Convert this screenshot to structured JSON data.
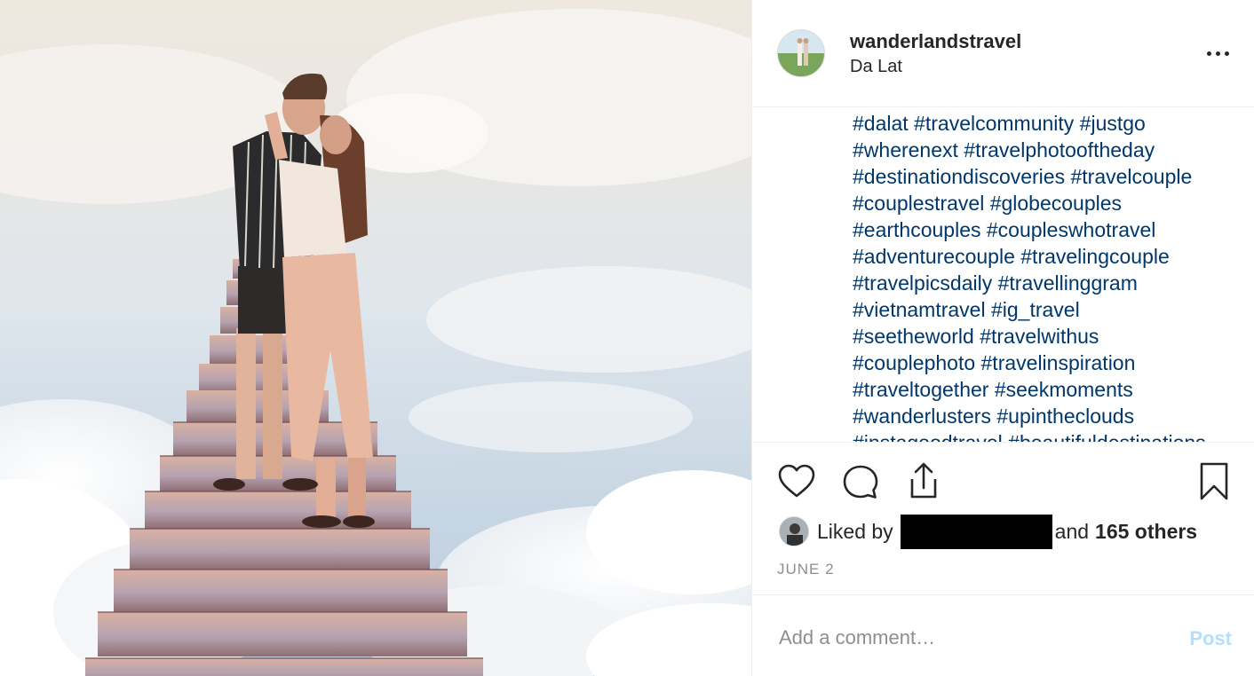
{
  "post": {
    "username": "wanderlandstravel",
    "location": "Da Lat",
    "hashtag_lines": [
      "#dalat #travelcommunity #justgo",
      "#wherenext #travelphotooftheday",
      "#destinationdiscoveries #travelcouple",
      "#couplestravel #globecouples",
      "#earthcouples #coupleswhotravel",
      "#adventurecouple #travelingcouple",
      "#travelpicsdaily #travellinggram",
      "#vietnamtravel #ig_travel",
      "#seetheworld #travelwithus",
      "#couplephoto #travelinspiration",
      "#traveltogether #seekmoments",
      "#wanderlusters #upintheclouds",
      "#instagoodtravel #beautifuldestinations"
    ],
    "likes": {
      "prefix": "Liked by",
      "connector": "and",
      "others": "165 others"
    },
    "date": "JUNE 2",
    "comment": {
      "placeholder": "Add a comment…",
      "post_label": "Post"
    }
  },
  "icons": {
    "like": "heart-icon",
    "comment": "comment-icon",
    "share": "share-icon",
    "save": "bookmark-icon",
    "more": "more-options-icon"
  },
  "colors": {
    "hashtag": "#00376b",
    "text": "#262626",
    "muted": "#8e8e8e",
    "post_disabled": "#b2dffc"
  }
}
